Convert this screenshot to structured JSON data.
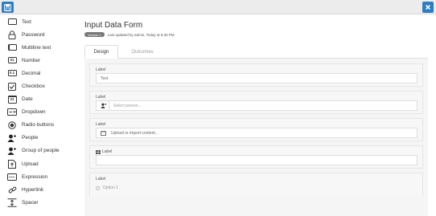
{
  "toolbar": {
    "save_icon": "save-icon",
    "close_icon": "close-icon"
  },
  "sidebar": {
    "items": [
      {
        "label": "Text",
        "icon": "text-box-icon"
      },
      {
        "label": "Password",
        "icon": "lock-icon"
      },
      {
        "label": "Multiline text",
        "icon": "multiline-box-icon"
      },
      {
        "label": "Number",
        "icon": "number-box-icon"
      },
      {
        "label": "Decimal",
        "icon": "decimal-box-icon"
      },
      {
        "label": "Checkbox",
        "icon": "checkbox-icon"
      },
      {
        "label": "Date",
        "icon": "calendar-icon"
      },
      {
        "label": "Dropdown",
        "icon": "dropdown-icon"
      },
      {
        "label": "Radio buttons",
        "icon": "radio-icon"
      },
      {
        "label": "People",
        "icon": "person-icon"
      },
      {
        "label": "Group of people",
        "icon": "group-icon"
      },
      {
        "label": "Upload",
        "icon": "upload-icon"
      },
      {
        "label": "Expression",
        "icon": "expression-icon"
      },
      {
        "label": "Hyperlink",
        "icon": "link-icon"
      },
      {
        "label": "Spacer",
        "icon": "spacer-icon"
      }
    ],
    "number_glyph": "01",
    "decimal_glyph": "0.1",
    "date_glyph": "31"
  },
  "header": {
    "title": "Input Data Form",
    "version": "Version 1",
    "updated": "Last updated by admin, Today at 6:30 PM"
  },
  "tabs": [
    {
      "label": "Design"
    },
    {
      "label": "Outcomes"
    }
  ],
  "fields": [
    {
      "label": "Label",
      "value": "Text"
    },
    {
      "label": "Label",
      "placeholder": "Select person..."
    },
    {
      "label": "Label",
      "placeholder": "Upload or import content..."
    },
    {
      "label": "Label",
      "value": ""
    },
    {
      "label": "Label",
      "option": "Option 1"
    }
  ],
  "colors": {
    "accent": "#2c7ec1"
  }
}
